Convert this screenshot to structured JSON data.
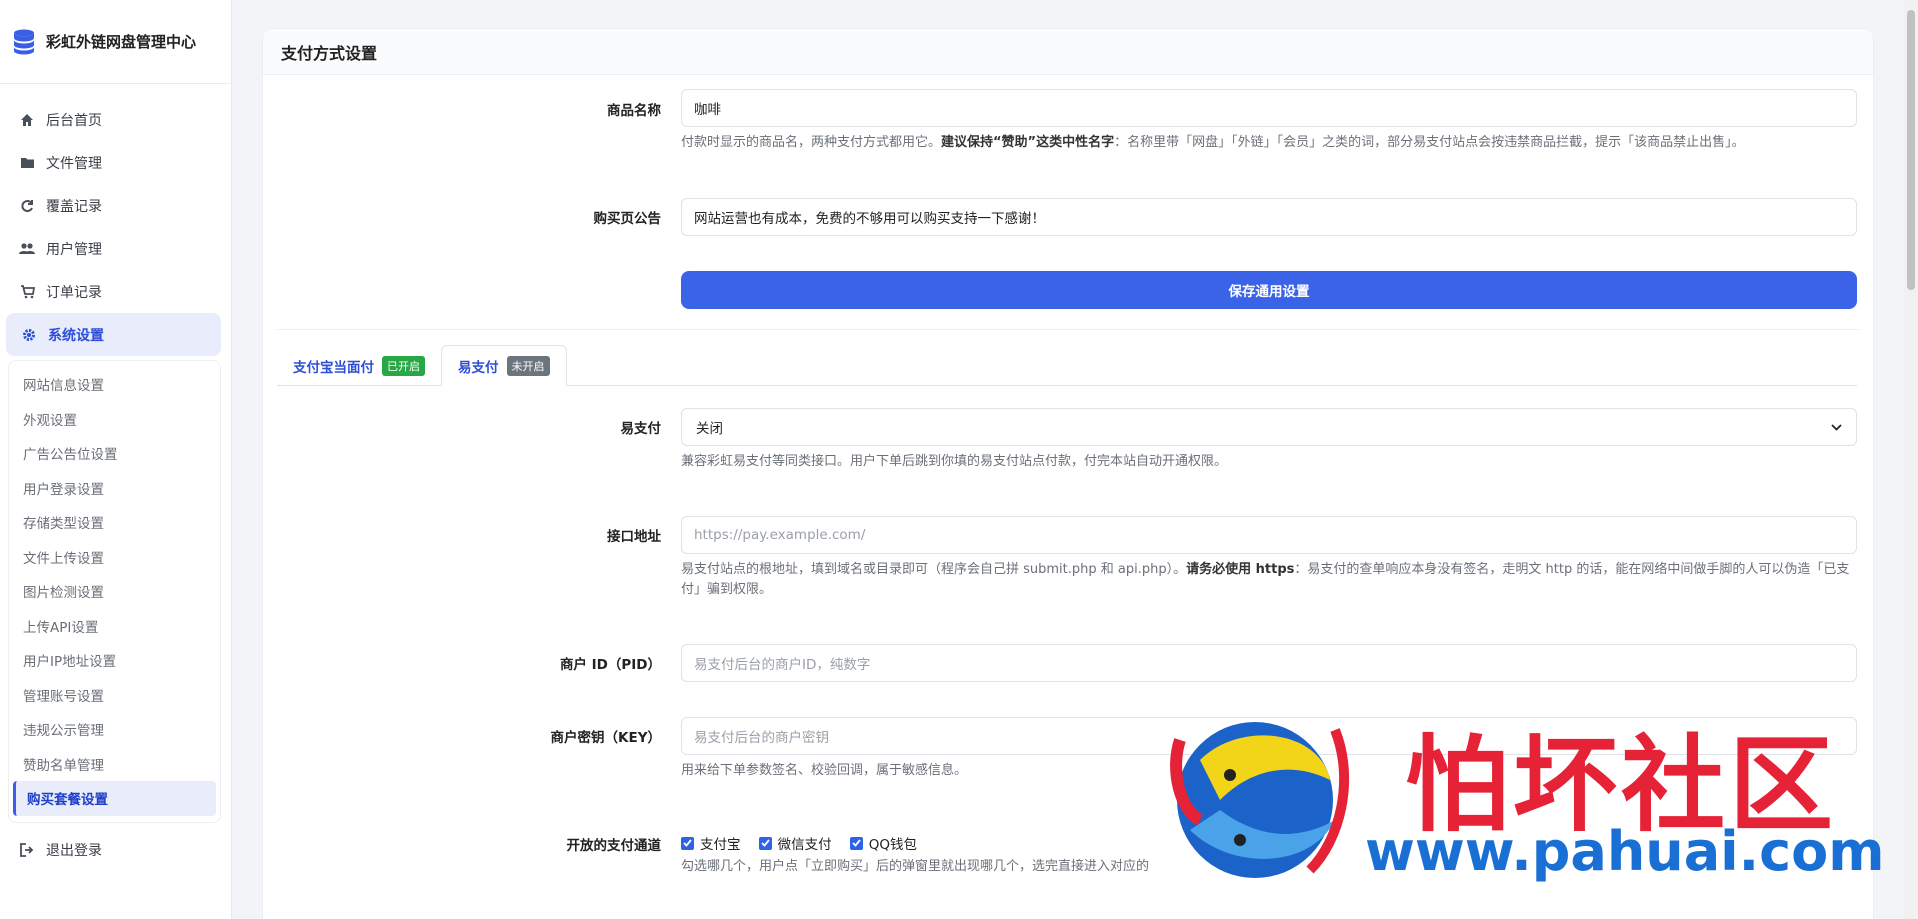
{
  "brand": {
    "title": "彩虹外链网盘管理中心"
  },
  "nav": [
    {
      "label": "后台首页",
      "icon": "home-icon"
    },
    {
      "label": "文件管理",
      "icon": "folder-icon"
    },
    {
      "label": "覆盖记录",
      "icon": "refresh-icon"
    },
    {
      "label": "用户管理",
      "icon": "users-icon"
    },
    {
      "label": "订单记录",
      "icon": "cart-icon"
    },
    {
      "label": "系统设置",
      "icon": "gear-icon"
    }
  ],
  "subnav": [
    "网站信息设置",
    "外观设置",
    "广告公告位设置",
    "用户登录设置",
    "存储类型设置",
    "文件上传设置",
    "图片检测设置",
    "上传API设置",
    "用户IP地址设置",
    "管理账号设置",
    "违规公示管理",
    "赞助名单管理",
    "购买套餐设置"
  ],
  "logout": "退出登录",
  "card": {
    "title": "支付方式设置"
  },
  "form": {
    "product_name": {
      "label": "商品名称",
      "value": "咖啡",
      "help_pre": "付款时显示的商品名，两种支付方式都用它。",
      "help_bold": "建议保持“赞助”这类中性名字",
      "help_post": "：名称里带「网盘」「外链」「会员」之类的词，部分易支付站点会按违禁商品拦截，提示「该商品禁止出售」。"
    },
    "notice": {
      "label": "购买页公告",
      "value": "网站运营也有成本，免费的不够用可以购买支持一下感谢！"
    },
    "save_label": "保存通用设置"
  },
  "tabs": [
    {
      "label": "支付宝当面付",
      "badge": "已开启",
      "state": "on"
    },
    {
      "label": "易支付",
      "badge": "未开启",
      "state": "off"
    }
  ],
  "epay": {
    "switch": {
      "label": "易支付",
      "value": "关闭",
      "help": "兼容彩虹易支付等同类接口。用户下单后跳到你填的易支付站点付款，付完本站自动开通权限。"
    },
    "api": {
      "label": "接口地址",
      "placeholder": "https://pay.example.com/",
      "help_pre": "易支付站点的根地址，填到域名或目录即可（程序会自己拼 submit.php 和 api.php）。",
      "help_bold": "请务必使用 https",
      "help_post": "：易支付的查单响应本身没有签名，走明文 http 的话，能在网络中间做手脚的人可以伪造「已支付」骗到权限。"
    },
    "pid": {
      "label": "商户 ID（PID）",
      "placeholder": "易支付后台的商户ID，纯数字"
    },
    "key": {
      "label": "商户密钥（KEY）",
      "placeholder": "易支付后台的商户密钥",
      "help": "用来给下单参数签名、校验回调，属于敏感信息。"
    },
    "channels": {
      "label": "开放的支付通道",
      "options": [
        "支付宝",
        "微信支付",
        "QQ钱包"
      ],
      "help": "勾选哪几个，用户点「立即购买」后的弹窗里就出现哪几个，选完直接进入对应的"
    }
  },
  "watermark": {
    "text": "怕坏社区",
    "url": "www.pahuai.com"
  }
}
